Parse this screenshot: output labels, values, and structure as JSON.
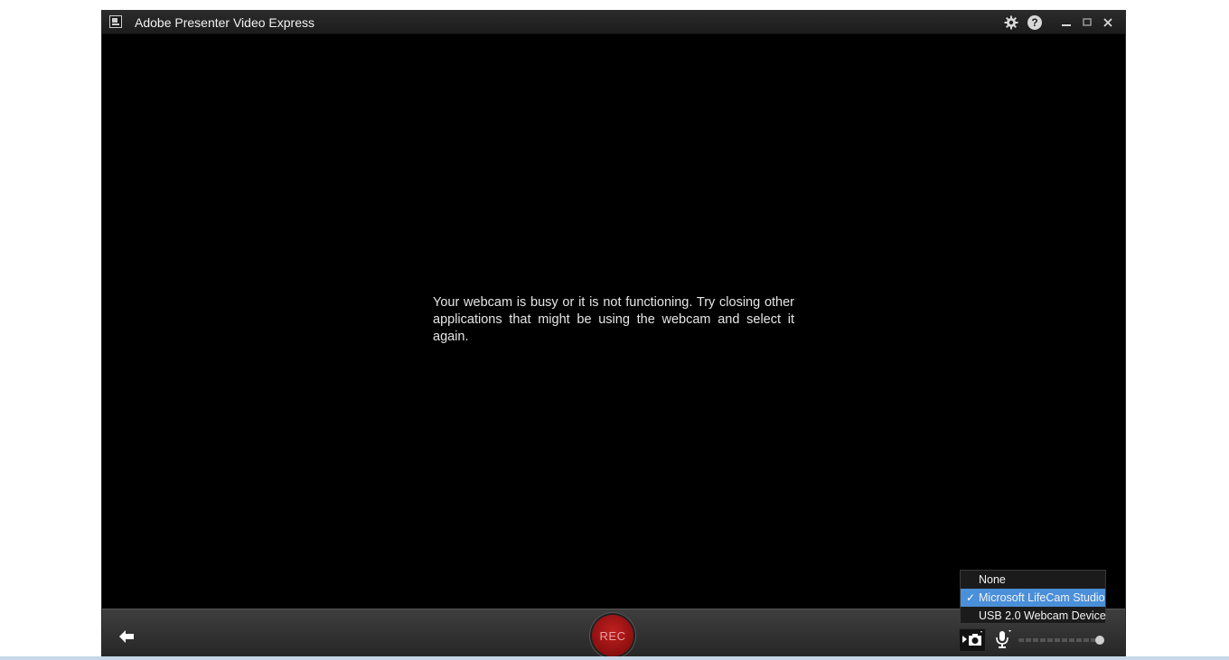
{
  "window": {
    "title": "Adobe Presenter Video Express",
    "icons": {
      "app": "app-icon",
      "settings": "gear-icon",
      "help": "help-icon",
      "minimize": "minimize-icon",
      "maximize": "maximize-icon",
      "close": "close-icon"
    },
    "help_glyph": "?"
  },
  "main": {
    "message": "Your webcam is busy or it is not functioning. Try closing other applications that might be using the webcam and select it again."
  },
  "bottom_bar": {
    "back_icon": "back-arrow-icon",
    "rec_label": "REC",
    "camera_icon": "camera-icon",
    "mic_icon": "microphone-icon",
    "volume_level": 1.0
  },
  "camera_menu": {
    "items": [
      {
        "label": "None",
        "selected": false
      },
      {
        "label": "Microsoft LifeCam Studio",
        "selected": true
      },
      {
        "label": "USB 2.0 Webcam Device",
        "selected": false
      }
    ],
    "check_glyph": "✓",
    "highlight_color": "#4a8fd9"
  },
  "colors": {
    "background": "#000000",
    "rec": "#b01515"
  }
}
